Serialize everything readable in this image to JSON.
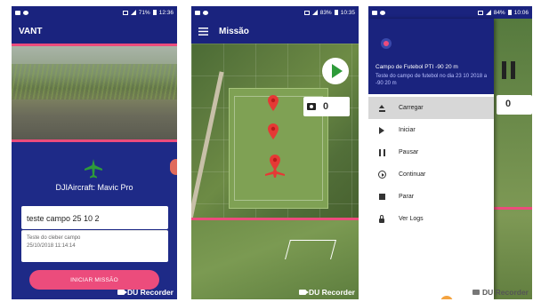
{
  "status": {
    "p1": {
      "battery": "71%",
      "time": "12:36"
    },
    "p2": {
      "battery": "83%",
      "time": "10:35"
    },
    "p3": {
      "battery": "84%",
      "time": "10:06"
    }
  },
  "screen1": {
    "title": "VANT",
    "aircraft": "DJIAircraft: Mavic Pro",
    "mission_name": "teste campo 25 10 2",
    "mission_desc": "Teste do cleber campo",
    "mission_date": "25/10/2018 11:14:14",
    "start_button": "INICIAR MISSÃO",
    "recorder": "DU Recorder"
  },
  "screen2": {
    "title": "Missão",
    "photo_count": "0",
    "recorder": "DU Recorder"
  },
  "screen3": {
    "drawer_title": "Campo de Futebol PTI -90 20 m",
    "drawer_subtitle": "Teste do campo de futebol no dia 23 10 2018 a -90 20 m",
    "menu": [
      {
        "label": "Carregar",
        "icon": "upload-icon"
      },
      {
        "label": "Iniciar",
        "icon": "play-icon"
      },
      {
        "label": "Pausar",
        "icon": "pause-icon"
      },
      {
        "label": "Continuar",
        "icon": "continue-icon"
      },
      {
        "label": "Parar",
        "icon": "stop-icon"
      },
      {
        "label": "Ver Logs",
        "icon": "lock-icon"
      }
    ],
    "bg_count": "0",
    "recorder": "DU Recorder"
  },
  "colors": {
    "primary": "#1a237e",
    "accent": "#ec4c7c",
    "green": "#2e9b3a",
    "pin": "#e53935"
  }
}
